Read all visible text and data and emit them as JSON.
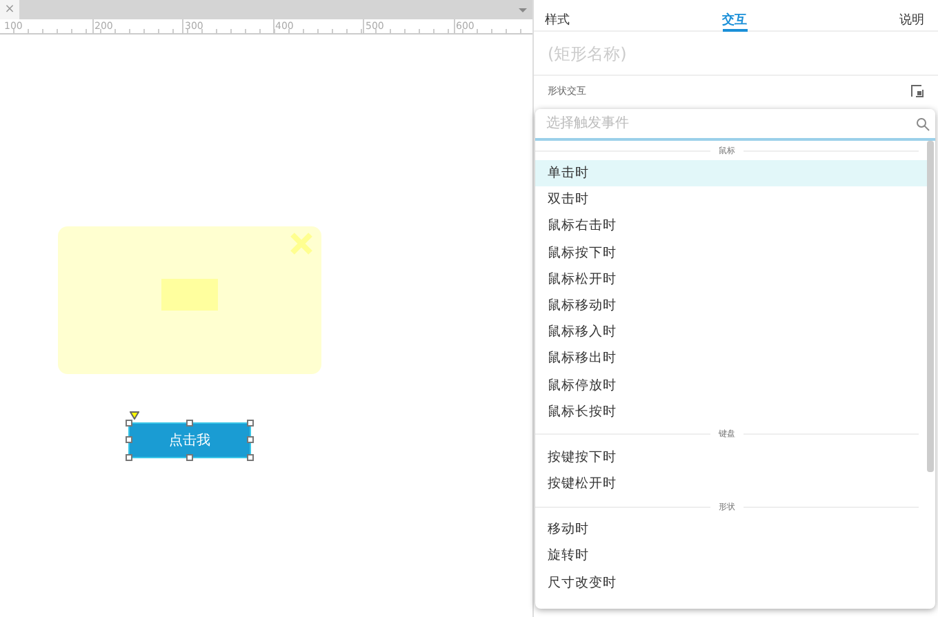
{
  "editor_tab": {
    "close": "×"
  },
  "ruler": {
    "ticks": [
      "100",
      "200",
      "300",
      "400",
      "500",
      "600"
    ]
  },
  "canvas": {
    "button_label": "点击我"
  },
  "panel": {
    "tabs": [
      {
        "label": "样式",
        "selected": false
      },
      {
        "label": "交互",
        "selected": true
      },
      {
        "label": "说明",
        "selected": false
      }
    ],
    "name_placeholder": "(矩形名称)",
    "section_label": "形状交互"
  },
  "event_dropdown": {
    "search": {
      "placeholder": "选择触发事件"
    },
    "groups": [
      {
        "label": "鼠标",
        "items": [
          {
            "label": "单击时",
            "selected": true
          },
          {
            "label": "双击时",
            "selected": false
          },
          {
            "label": "鼠标右击时",
            "selected": false
          },
          {
            "label": "鼠标按下时",
            "selected": false
          },
          {
            "label": "鼠标松开时",
            "selected": false
          },
          {
            "label": "鼠标移动时",
            "selected": false
          },
          {
            "label": "鼠标移入时",
            "selected": false
          },
          {
            "label": "鼠标移出时",
            "selected": false
          },
          {
            "label": "鼠标停放时",
            "selected": false
          },
          {
            "label": "鼠标长按时",
            "selected": false
          }
        ]
      },
      {
        "label": "键盘",
        "items": [
          {
            "label": "按键按下时",
            "selected": false
          },
          {
            "label": "按键松开时",
            "selected": false
          }
        ]
      },
      {
        "label": "形状",
        "items": [
          {
            "label": "移动时",
            "selected": false
          },
          {
            "label": "旋转时",
            "selected": false
          },
          {
            "label": "尺寸改变时",
            "selected": false
          }
        ]
      }
    ]
  }
}
